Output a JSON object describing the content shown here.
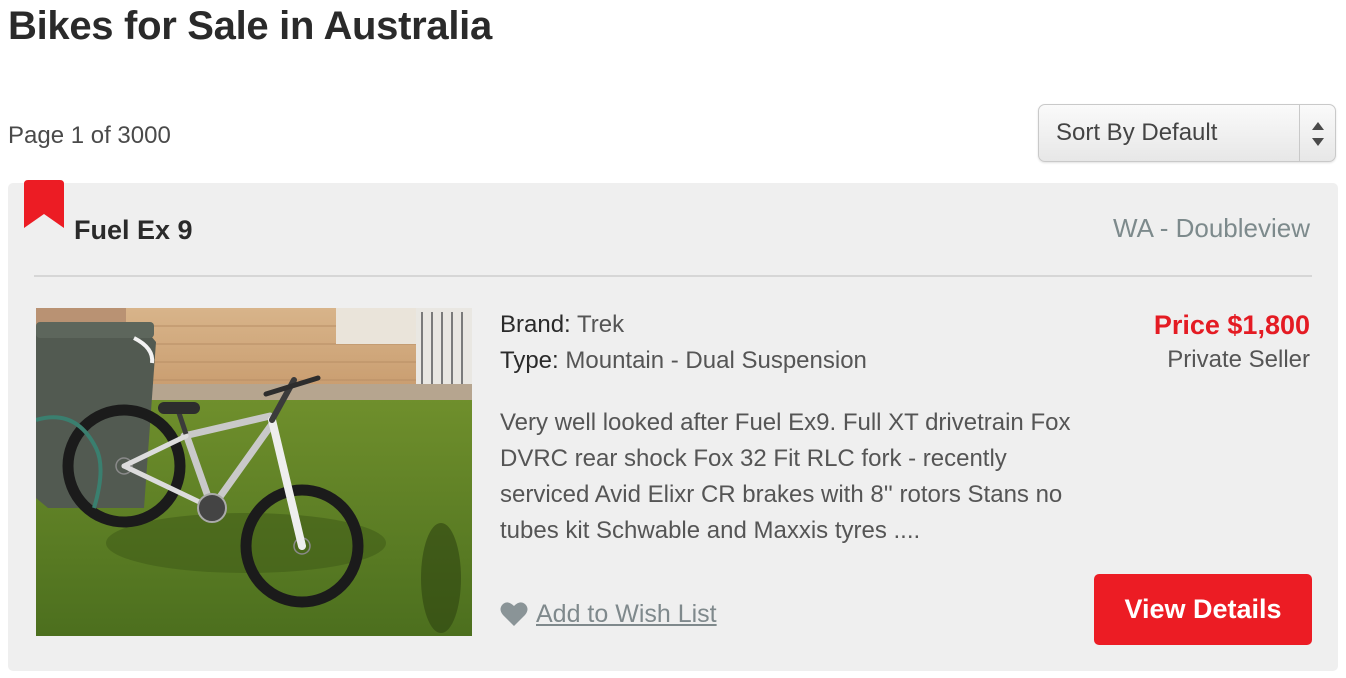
{
  "header": {
    "title": "Bikes for Sale in Australia"
  },
  "pagination": {
    "text": "Page 1 of 3000"
  },
  "sort": {
    "selected": "Sort By Default"
  },
  "listing": {
    "title": "Fuel Ex 9",
    "location": "WA - Doubleview",
    "brand_label": "Brand:",
    "brand_value": "Trek",
    "type_label": "Type:",
    "type_value": "Mountain - Dual Suspension",
    "description": "Very well looked after Fuel Ex9. Full XT drivetrain Fox DVRC rear shock Fox 32 Fit RLC fork - recently serviced Avid Elixr CR brakes with 8'' rotors Stans no tubes kit Schwable and Maxxis tyres ....",
    "price": "Price $1,800",
    "seller": "Private Seller",
    "wishlist_label": "Add to Wish List",
    "view_details_label": "View Details"
  },
  "icons": {
    "bookmark": "bookmark-icon",
    "heart": "heart-icon",
    "sort_arrows": "sort-arrows-icon"
  },
  "colors": {
    "accent_red": "#ec1c24",
    "price_red": "#e41b23",
    "card_bg": "#efefef",
    "muted_text": "#7d8a8c"
  }
}
